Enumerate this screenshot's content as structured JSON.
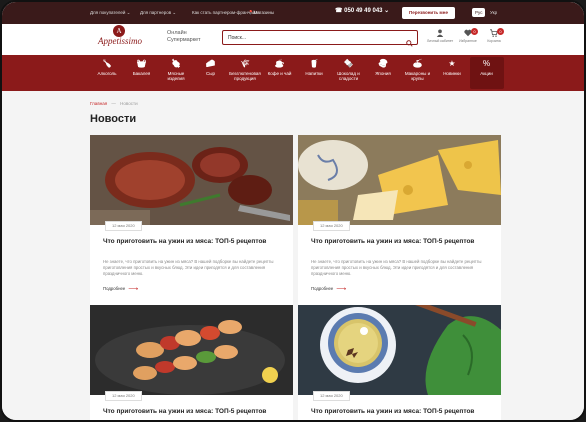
{
  "topbar": {
    "buyers": "Для покупателей ⌄",
    "partners": "Для партнеров ⌄",
    "franchise": "Как стать партнером-франчайзи",
    "shops": "Магазины",
    "phone": "050 49 49 043 ⌄",
    "call_label": "Перезвонить мне",
    "lang_ru": "Рус",
    "lang_ua": "Укр"
  },
  "header": {
    "logo_mark": "A",
    "logo_text": "Appetissimo",
    "tagline_1": "Онлайн",
    "tagline_2": "Супермаркет",
    "search_placeholder": "Поиск...",
    "account_label": "Личный кабинет",
    "wishlist_label": "Избранное",
    "cart_label": "Корзина",
    "wishlist_count": "0",
    "cart_count": "0"
  },
  "nav": {
    "items": [
      {
        "label": "Алкоголь",
        "icon": "bottle-icon"
      },
      {
        "label": "Бакалея",
        "icon": "grocery-icon"
      },
      {
        "label": "Мясные изделия",
        "icon": "meat-icon"
      },
      {
        "label": "Сыр",
        "icon": "cheese-icon"
      },
      {
        "label": "Безглютеновая продукция",
        "icon": "gluten-free-icon"
      },
      {
        "label": "Кофе и чай",
        "icon": "coffee-icon"
      },
      {
        "label": "Напитки",
        "icon": "drink-icon"
      },
      {
        "label": "Шоколад и сладости",
        "icon": "chocolate-icon"
      },
      {
        "label": "Япония",
        "icon": "japan-icon"
      },
      {
        "label": "Макароны и крупы",
        "icon": "pasta-icon"
      },
      {
        "label": "Новинки",
        "icon": "new-icon"
      },
      {
        "label": "Акции",
        "icon": "sale-icon"
      }
    ],
    "accent": "#8b1a1a"
  },
  "breadcrumb": {
    "home": "Главная",
    "sep": "—",
    "current": "Новости"
  },
  "page_title": "Новости",
  "cards": [
    {
      "date": "12 мая 2020",
      "title": "Что приготовить на ужин из мяса: ТОП-5 рецептов",
      "text": "Не знаете, что приготовить на ужин из мяса? В нашей подборке вы найдете рецепты приготовления простых и вкусных блюд. Эти идеи пригодятся и для составления праздничного меню.",
      "more": "Подробнее"
    },
    {
      "date": "12 мая 2020",
      "title": "Что приготовить на ужин из мяса: ТОП-5 рецептов",
      "text": "Не знаете, что приготовить на ужин из мяса? В нашей подборке вы найдете рецепты приготовления простых и вкусных блюд. Эти идеи пригодятся и для составления праздничного меню.",
      "more": "Подробнее"
    },
    {
      "date": "12 мая 2020",
      "title": "Что приготовить на ужин из мяса: ТОП-5 рецептов"
    },
    {
      "date": "12 мая 2020",
      "title": "Что приготовить на ужин из мяса: ТОП-5 рецептов"
    }
  ]
}
